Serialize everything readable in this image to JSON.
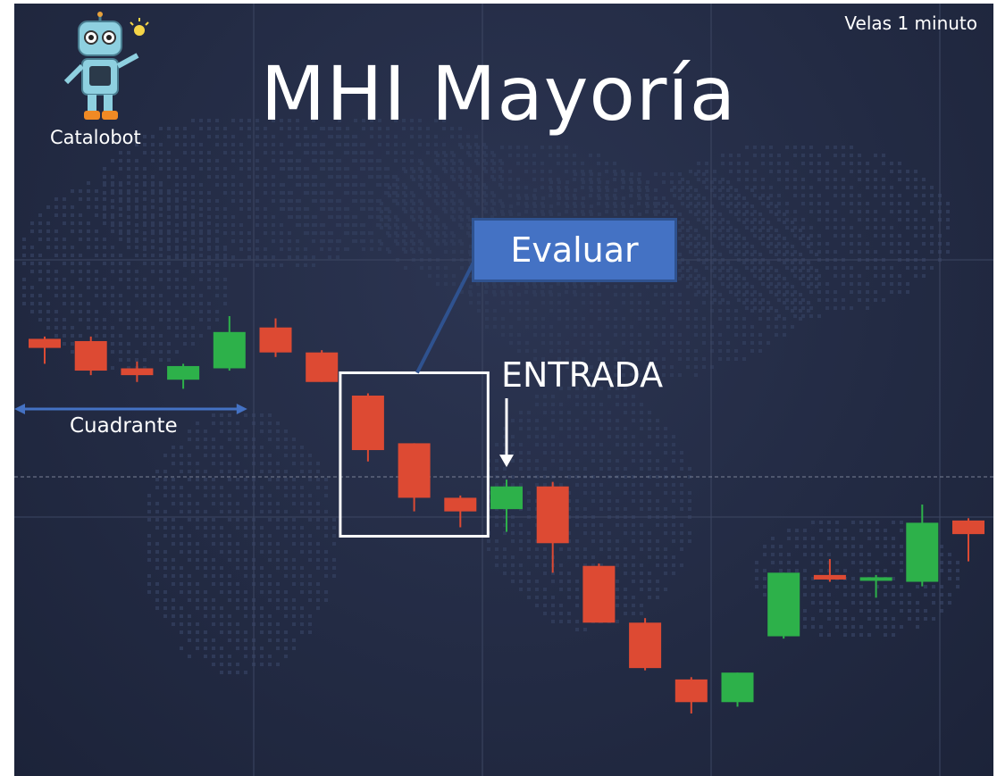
{
  "title": "MHI Mayoría",
  "timeframe_label": "Velas 1 minuto",
  "brand": {
    "name": "Catalobot",
    "logo_icon": "robot-icon"
  },
  "annotations": {
    "evaluate_label": "Evaluar",
    "entry_label": "ENTRADA",
    "quadrant_label": "Cuadrante"
  },
  "colors": {
    "bullish": "#2db14a",
    "bearish": "#dd4a33",
    "background": "#232b44",
    "callout": "#4472c4"
  },
  "chart_data": {
    "type": "candlestick",
    "title": "MHI Mayoría",
    "ylim": [
      0,
      100
    ],
    "reference_line": 30,
    "candles": [
      {
        "o": 90,
        "c": 86,
        "h": 91,
        "l": 79,
        "dir": "down"
      },
      {
        "o": 89,
        "c": 76,
        "h": 91,
        "l": 74,
        "dir": "down"
      },
      {
        "o": 77,
        "c": 74,
        "h": 80,
        "l": 71,
        "dir": "down"
      },
      {
        "o": 72,
        "c": 78,
        "h": 79,
        "l": 68,
        "dir": "up"
      },
      {
        "o": 77,
        "c": 93,
        "h": 100,
        "l": 76,
        "dir": "up"
      },
      {
        "o": 95,
        "c": 84,
        "h": 99,
        "l": 82,
        "dir": "down"
      },
      {
        "o": 84,
        "c": 71,
        "h": 85,
        "l": 71,
        "dir": "down"
      },
      {
        "o": 65,
        "c": 41,
        "h": 66,
        "l": 36,
        "dir": "down"
      },
      {
        "o": 44,
        "c": 20,
        "h": 44,
        "l": 14,
        "dir": "down"
      },
      {
        "o": 20,
        "c": 14,
        "h": 21,
        "l": 7,
        "dir": "down"
      },
      {
        "o": 15,
        "c": 25,
        "h": 28,
        "l": 5,
        "dir": "up"
      },
      {
        "o": 25,
        "c": 0,
        "h": 27,
        "l": -13,
        "dir": "down"
      },
      {
        "o": -10,
        "c": -35,
        "h": -9,
        "l": -35,
        "dir": "down"
      },
      {
        "o": -35,
        "c": -55,
        "h": -33,
        "l": -56,
        "dir": "down"
      },
      {
        "o": -60,
        "c": -70,
        "h": -59,
        "l": -75,
        "dir": "down"
      },
      {
        "o": -70,
        "c": -57,
        "h": -57,
        "l": -72,
        "dir": "up"
      },
      {
        "o": -41,
        "c": -13,
        "h": -13,
        "l": -42,
        "dir": "up"
      },
      {
        "o": -14,
        "c": -16,
        "h": -7,
        "l": -17,
        "dir": "down"
      },
      {
        "o": -16,
        "c": -15,
        "h": -14,
        "l": -24,
        "dir": "up"
      },
      {
        "o": -17,
        "c": 9,
        "h": 17,
        "l": -19,
        "dir": "up"
      },
      {
        "o": 10,
        "c": 4,
        "h": 11,
        "l": -8,
        "dir": "down"
      }
    ],
    "evaluate_window": [
      7,
      9
    ],
    "entry_index": 10,
    "quadrant": [
      0,
      4
    ]
  }
}
